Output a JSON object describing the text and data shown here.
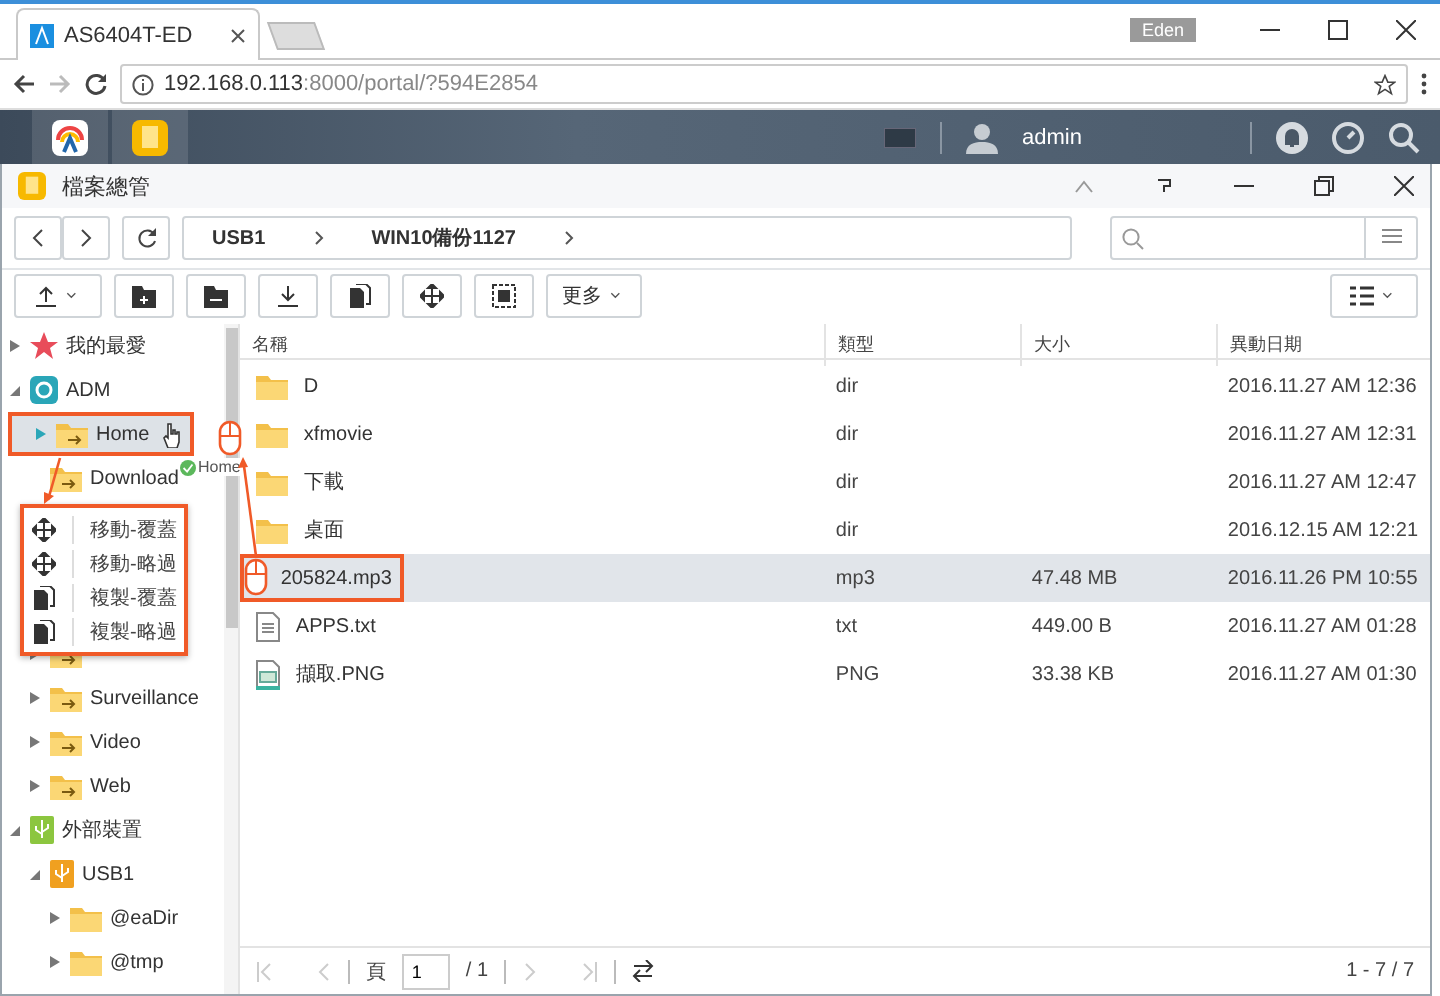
{
  "browser": {
    "tab_title": "AS6404T-ED",
    "user_badge": "Eden",
    "url_host": "192.168.0.113",
    "url_rest": ":8000/portal/?594E2854"
  },
  "topbar": {
    "user": "admin"
  },
  "window": {
    "title": "檔案總管"
  },
  "breadcrumb": [
    "USB1",
    "WIN10備份1127"
  ],
  "toolbar": {
    "more": "更多"
  },
  "sidebar": {
    "items": [
      {
        "label": "我的最愛",
        "kind": "favorites",
        "expanded": false,
        "selected": false
      },
      {
        "label": "ADM",
        "kind": "adm",
        "expanded": true,
        "selected": false,
        "children": [
          {
            "label": "Home",
            "kind": "share",
            "expanded": false,
            "selected": true,
            "highlighted": true
          },
          {
            "label": "Download",
            "kind": "share",
            "expanded": false,
            "selected": false,
            "highlighted": false,
            "leaf": true
          },
          {
            "kind": "share",
            "expanded": false,
            "selected": false,
            "highlighted": false
          },
          {
            "label": "Surveillance",
            "kind": "share",
            "expanded": false,
            "selected": false,
            "highlighted": false
          },
          {
            "label": "Video",
            "kind": "share",
            "expanded": false,
            "selected": false,
            "highlighted": false
          },
          {
            "label": "Web",
            "kind": "share",
            "expanded": false,
            "selected": false,
            "highlighted": false
          }
        ]
      },
      {
        "label": "外部裝置",
        "kind": "external",
        "expanded": true,
        "selected": false,
        "children": [
          {
            "label": "USB1",
            "kind": "usb",
            "expanded": true,
            "selected": false,
            "highlighted": false,
            "children": [
              {
                "label": "@eaDir",
                "kind": "folder",
                "expanded": false,
                "selected": false,
                "highlighted": false
              },
              {
                "label": "@tmp",
                "kind": "folder",
                "expanded": false,
                "selected": false,
                "highlighted": false
              }
            ]
          }
        ]
      }
    ]
  },
  "table": {
    "columns": [
      "名稱",
      "類型",
      "大小",
      "異動日期"
    ],
    "rows": [
      {
        "name": "D",
        "kind": "folder",
        "type": "dir",
        "size": "",
        "date": "2016.11.27 AM 12:36",
        "selected": false,
        "highlighted": false
      },
      {
        "name": "xfmovie",
        "kind": "folder",
        "type": "dir",
        "size": "",
        "date": "2016.11.27 AM 12:31",
        "selected": false,
        "highlighted": false
      },
      {
        "name": "下載",
        "kind": "folder",
        "type": "dir",
        "size": "",
        "date": "2016.11.27 AM 12:47",
        "selected": false,
        "highlighted": false
      },
      {
        "name": "桌面",
        "kind": "folder",
        "type": "dir",
        "size": "",
        "date": "2016.12.15 AM 12:21",
        "selected": false,
        "highlighted": false
      },
      {
        "name": "205824.mp3",
        "kind": "audio",
        "type": "mp3",
        "size": "47.48 MB",
        "date": "2016.11.26 PM 10:55",
        "selected": true,
        "highlighted": true
      },
      {
        "name": "APPS.txt",
        "kind": "text",
        "type": "txt",
        "size": "449.00 B",
        "date": "2016.11.27 AM 01:28",
        "selected": false,
        "highlighted": false
      },
      {
        "name": "擷取.PNG",
        "kind": "image",
        "type": "PNG",
        "size": "33.38 KB",
        "date": "2016.11.27 AM 01:30",
        "selected": false,
        "highlighted": false
      }
    ]
  },
  "pagination": {
    "page_label": "頁",
    "page": "1",
    "total": "/ 1",
    "range": "1 - 7 / 7"
  },
  "drag": {
    "label": "Home",
    "menu": [
      {
        "label": "移動-覆蓋",
        "kind": "move"
      },
      {
        "label": "移動-略過",
        "kind": "move"
      },
      {
        "label": "複製-覆蓋",
        "kind": "copy"
      },
      {
        "label": "複製-略過",
        "kind": "copy"
      }
    ]
  }
}
